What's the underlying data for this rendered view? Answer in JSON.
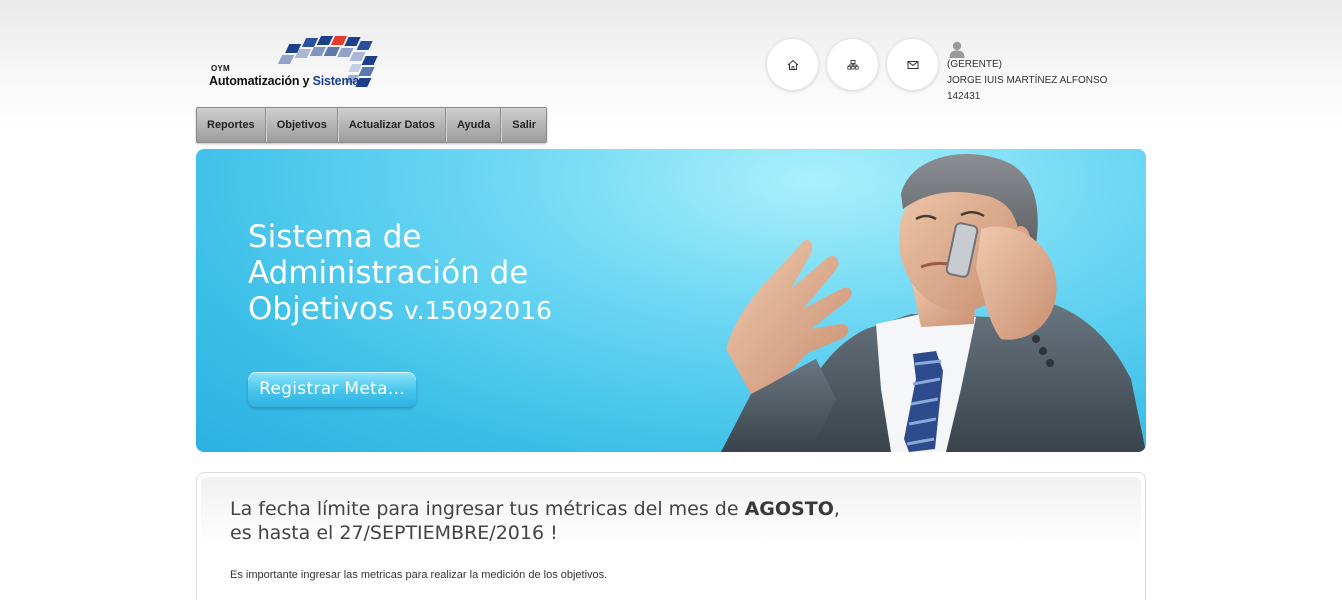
{
  "logo": {
    "small": "OYM",
    "name_part1": "Automatización y ",
    "name_part2": "Sistemas"
  },
  "header_buttons": [
    {
      "icon": "home-icon"
    },
    {
      "icon": "sitemap-icon"
    },
    {
      "icon": "mail-icon"
    }
  ],
  "user": {
    "icon": "user-icon",
    "role": "(GERENTE)",
    "name": "JORGE IUIS MARTÍNEZ ALFONSO",
    "id": "142431"
  },
  "menu": {
    "items": [
      {
        "label": "Reportes"
      },
      {
        "label": "Objetivos"
      },
      {
        "label": "Actualizar Datos"
      },
      {
        "label": "Ayuda"
      },
      {
        "label": "Salir"
      }
    ]
  },
  "banner": {
    "title_line1": "Sistema de",
    "title_line2": "Administración de",
    "title_line3": "Objetivos",
    "version": "v.15092016",
    "button_label": "Registrar Meta..."
  },
  "notice": {
    "line1_prefix": "La fecha límite para ingresar tus métricas del mes de ",
    "month": "AGOSTO",
    "line1_suffix": ",",
    "line2": "es hasta el 27/SEPTIEMBRE/2016 !",
    "sub": "Es importante ingresar las metricas para realizar la medición de los objetivos."
  },
  "colors": {
    "banner_blue": "#3bbfe8",
    "menu_gray": "#b5b5b5",
    "logo_blue": "#1e3f8a",
    "logo_red": "#e53b2c"
  }
}
